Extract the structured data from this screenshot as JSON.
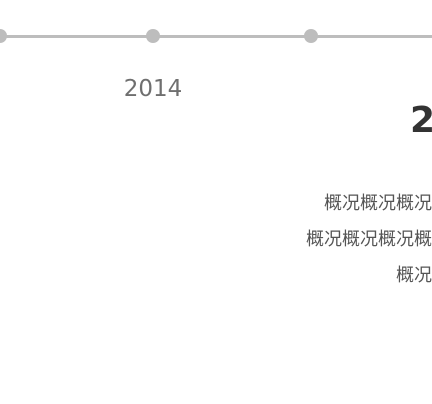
{
  "timeline": {
    "items": [
      {
        "year": "",
        "state": "edge"
      },
      {
        "year": "2014",
        "state": "inactive"
      },
      {
        "year": "",
        "state": "inactive"
      }
    ],
    "active_year": "2",
    "description_lines": [
      "概况概况概况",
      "概况概况概况概",
      "概况"
    ]
  },
  "colors": {
    "track": "#bdbdbd",
    "dot": "#bdbdbd",
    "label": "#6f6f6f",
    "active_year": "#333333",
    "description": "#555555"
  }
}
